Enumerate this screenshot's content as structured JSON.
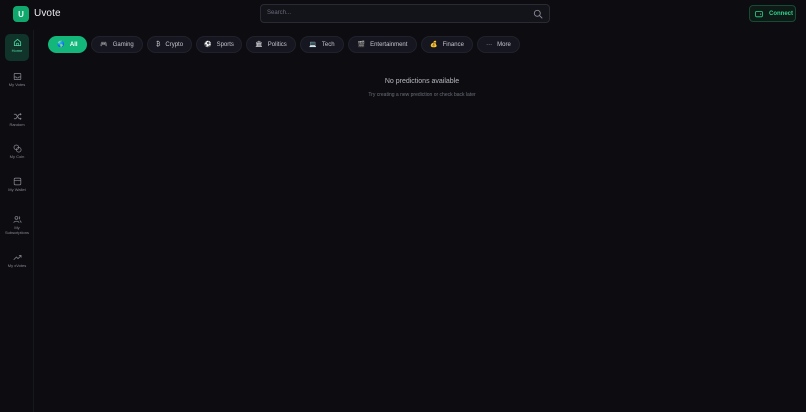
{
  "header": {
    "logo_letter": "U",
    "app_name": "Uvote",
    "search_placeholder": "Search...",
    "connect_label": "Connect"
  },
  "sidebar": {
    "items": [
      {
        "label": "Home",
        "icon": "home-icon",
        "active": true
      },
      {
        "label": "My Votes",
        "icon": "inbox-icon",
        "active": false
      },
      {
        "label": "Random",
        "icon": "shuffle-icon",
        "active": false
      },
      {
        "label": "My Coin",
        "icon": "coins-icon",
        "active": false
      },
      {
        "label": "My Wallet",
        "icon": "wallet-icon",
        "active": false
      },
      {
        "label": "My Subscriptions",
        "icon": "users-icon",
        "active": false
      },
      {
        "label": "My xVotes",
        "icon": "trending-up-icon",
        "active": false
      }
    ]
  },
  "categories": [
    {
      "label": "All",
      "icon": "🌎",
      "active": true
    },
    {
      "label": "Gaming",
      "icon": "🎮",
      "active": false
    },
    {
      "label": "Crypto",
      "icon": "₿",
      "active": false
    },
    {
      "label": "Sports",
      "icon": "⚽",
      "active": false
    },
    {
      "label": "Politics",
      "icon": "🏛",
      "active": false
    },
    {
      "label": "Tech",
      "icon": "💻",
      "active": false
    },
    {
      "label": "Entertainment",
      "icon": "🎬",
      "active": false
    },
    {
      "label": "Finance",
      "icon": "💰",
      "active": false
    },
    {
      "label": "More",
      "icon": "···",
      "active": false
    }
  ],
  "empty_state": {
    "title": "No predictions available",
    "subtitle": "Try creating a new prediction or check back later"
  },
  "colors": {
    "background": "#0c0c11",
    "accent": "#14b77a",
    "accent_text": "#2fd38e"
  }
}
